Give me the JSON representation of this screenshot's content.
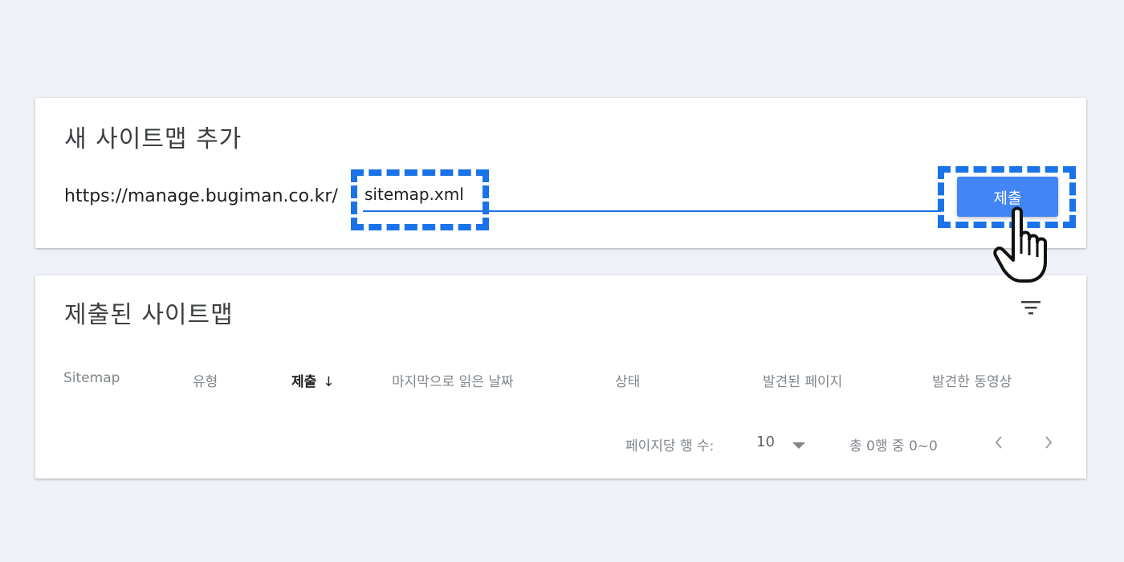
{
  "add_card": {
    "title": "새 사이트맵 추가",
    "url_prefix": "https://manage.bugiman.co.kr/",
    "input_value": "sitemap.xml",
    "submit_label": "제출"
  },
  "list_card": {
    "title": "제출된 사이트맵",
    "columns": [
      "Sitemap",
      "유형",
      "제출",
      "마지막으로 읽은 날짜",
      "상태",
      "발견된 페이지",
      "발견한 동영상"
    ],
    "sorted_column_arrow": "↓",
    "rows_per_page_label": "페이지당 행 수:",
    "rows_per_page_value": "10",
    "range_text": "총 0행 중 0~0"
  },
  "colors": {
    "accent": "#1a73e8",
    "button": "#4285f4",
    "background": "#eef1f6"
  },
  "icons": [
    "filter-icon",
    "hand-pointer-icon",
    "chevron-left-icon",
    "chevron-right-icon",
    "sort-arrow-down-icon",
    "dropdown-caret-icon"
  ]
}
